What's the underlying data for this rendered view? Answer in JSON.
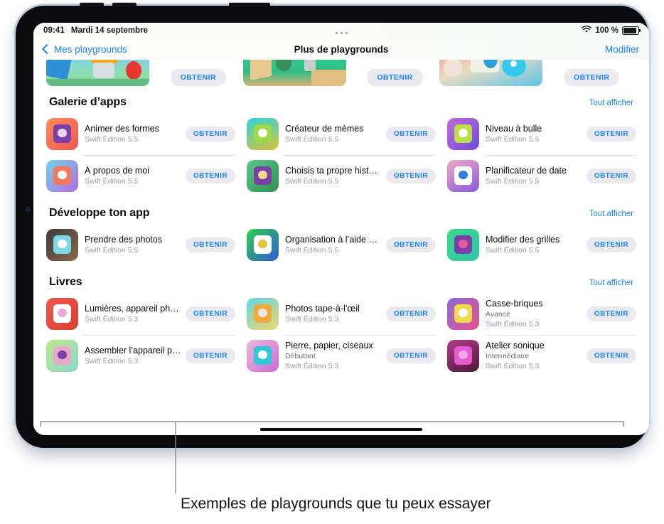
{
  "statusbar": {
    "time": "09:41",
    "date": "Mardi 14 septembre",
    "battery_percent": "100 %",
    "wifi_icon": "wifi-icon",
    "battery_icon": "battery-icon",
    "dots_icon": "more-dots-icon"
  },
  "navbar": {
    "back_label": "Mes playgrounds",
    "back_icon": "chevron-left-icon",
    "title": "Plus de playgrounds",
    "edit_label": "Modifier"
  },
  "labels": {
    "get": "OBTENIR",
    "see_all": "Tout afficher"
  },
  "carousel": {
    "items": [
      {
        "name": "promo-card-1",
        "get": "OBTENIR"
      },
      {
        "name": "promo-card-2",
        "get": "OBTENIR"
      },
      {
        "name": "promo-card-3",
        "get": "OBTENIR"
      }
    ]
  },
  "sections": [
    {
      "title": "Galerie d’apps",
      "see_all": "Tout afficher",
      "columns": [
        [
          {
            "name": "Animer des formes",
            "level": "",
            "version": "Swift Édition 5.5",
            "get": "OBTENIR"
          },
          {
            "name": "À propos de moi",
            "level": "",
            "version": "Swift Édition 5.5",
            "get": "OBTENIR"
          }
        ],
        [
          {
            "name": "Créateur de mèmes",
            "level": "",
            "version": "Swift Édition 5.5",
            "get": "OBTENIR"
          },
          {
            "name": "Choisis ta propre histoire",
            "level": "",
            "version": "Swift Édition 5.5",
            "get": "OBTENIR"
          }
        ],
        [
          {
            "name": "Niveau à bulle",
            "level": "",
            "version": "Swift Édition 5.5",
            "get": "OBTENIR"
          },
          {
            "name": "Planificateur de date",
            "level": "",
            "version": "Swift Édition 5.5",
            "get": "OBTENIR"
          }
        ]
      ]
    },
    {
      "title": "Développe ton app",
      "see_all": "Tout afficher",
      "columns": [
        [
          {
            "name": "Prendre des photos",
            "level": "",
            "version": "Swift Édition 5.5",
            "get": "OBTENIR"
          }
        ],
        [
          {
            "name": "Organisation à l’aide de grilles",
            "level": "",
            "version": "Swift Édition 5.5",
            "get": "OBTENIR"
          }
        ],
        [
          {
            "name": "Modifier des grilles",
            "level": "",
            "version": "Swift Édition 5.5",
            "get": "OBTENIR"
          }
        ]
      ]
    },
    {
      "title": "Livres",
      "see_all": "Tout afficher",
      "columns": [
        [
          {
            "name": "Lumières, appareil photo, code",
            "level": "",
            "version": "Swift Édition 5.3",
            "get": "OBTENIR"
          },
          {
            "name": "Assembler l’appareil photo",
            "level": "",
            "version": "Swift Édition 5.3",
            "get": "OBTENIR"
          }
        ],
        [
          {
            "name": "Photos tape-à-l’œil",
            "level": "",
            "version": "Swift Édition 5.3",
            "get": "OBTENIR"
          },
          {
            "name": "Pierre, papier, ciseaux",
            "level": "Débutant",
            "version": "Swift Édition 5.3",
            "get": "OBTENIR"
          }
        ],
        [
          {
            "name": "Casse-briques",
            "level": "Avancé",
            "version": "Swift Édition 5.3",
            "get": "OBTENIR"
          },
          {
            "name": "Atelier sonique",
            "level": "Intermédiaire",
            "version": "Swift Édition 5.3",
            "get": "OBTENIR"
          }
        ]
      ]
    }
  ],
  "callout": {
    "caption": "Exemples de playgrounds que tu peux essayer"
  },
  "colors": {
    "accent_blue": "#1a84ff",
    "get_button_bg": "#e9e9ef",
    "divider": "#e2e2e6",
    "text_primary": "#0a0a0a",
    "text_secondary": "#9b9ba2"
  }
}
